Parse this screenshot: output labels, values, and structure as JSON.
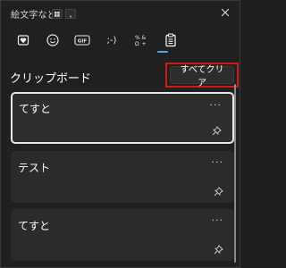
{
  "window": {
    "title": "絵文字など"
  },
  "tabs": [
    {
      "name": "recent",
      "icon": "heart-icon"
    },
    {
      "name": "emoji",
      "icon": "smiley-icon"
    },
    {
      "name": "gif",
      "icon": "gif-icon",
      "label": "GIF"
    },
    {
      "name": "kaomoji",
      "icon": "kaomoji-icon",
      "label": ";-)"
    },
    {
      "name": "symbols",
      "icon": "symbols-icon"
    },
    {
      "name": "clipboard",
      "icon": "clipboard-icon",
      "selected": true
    }
  ],
  "clipboard": {
    "heading": "クリップボード",
    "clear_all_label": "すべてクリア",
    "items": [
      {
        "text": "てすと",
        "selected": true
      },
      {
        "text": "テスト",
        "selected": false
      },
      {
        "text": "てすと",
        "selected": false
      }
    ],
    "more_glyph": "···"
  },
  "colors": {
    "background": "#202020",
    "card": "#2b2b2b",
    "accent": "#5ea0e6",
    "highlight": "#d1191c"
  }
}
